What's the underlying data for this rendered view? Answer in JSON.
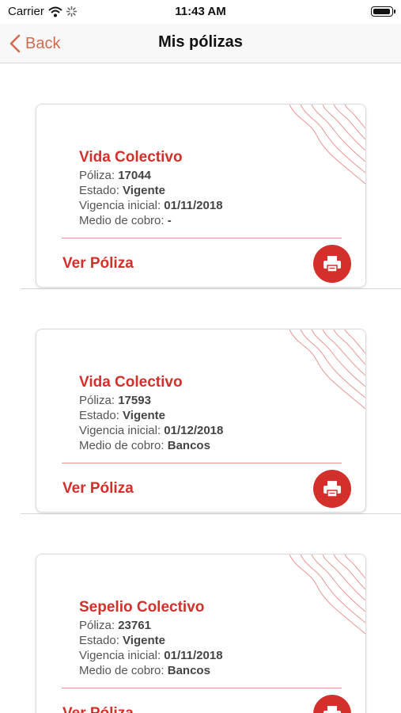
{
  "status_bar": {
    "carrier": "Carrier",
    "time": "11:43 AM"
  },
  "nav": {
    "back_label": "Back",
    "title": "Mis pólizas"
  },
  "labels": {
    "poliza": "Póliza:",
    "estado": "Estado:",
    "vigencia": "Vigencia inicial:",
    "medio": "Medio de cobro:",
    "ver_poliza": "Ver Póliza"
  },
  "policies": [
    {
      "title": "Vida Colectivo",
      "poliza": "17044",
      "estado": "Vigente",
      "vigencia": "01/11/2018",
      "medio": "-"
    },
    {
      "title": "Vida Colectivo",
      "poliza": "17593",
      "estado": "Vigente",
      "vigencia": "01/12/2018",
      "medio": "Bancos"
    },
    {
      "title": "Sepelio Colectivo",
      "poliza": "23761",
      "estado": "Vigente",
      "vigencia": "01/11/2018",
      "medio": "Bancos"
    }
  ],
  "colors": {
    "accent": "#d3302b",
    "back": "#d26b4f",
    "divider": "#e79893"
  }
}
